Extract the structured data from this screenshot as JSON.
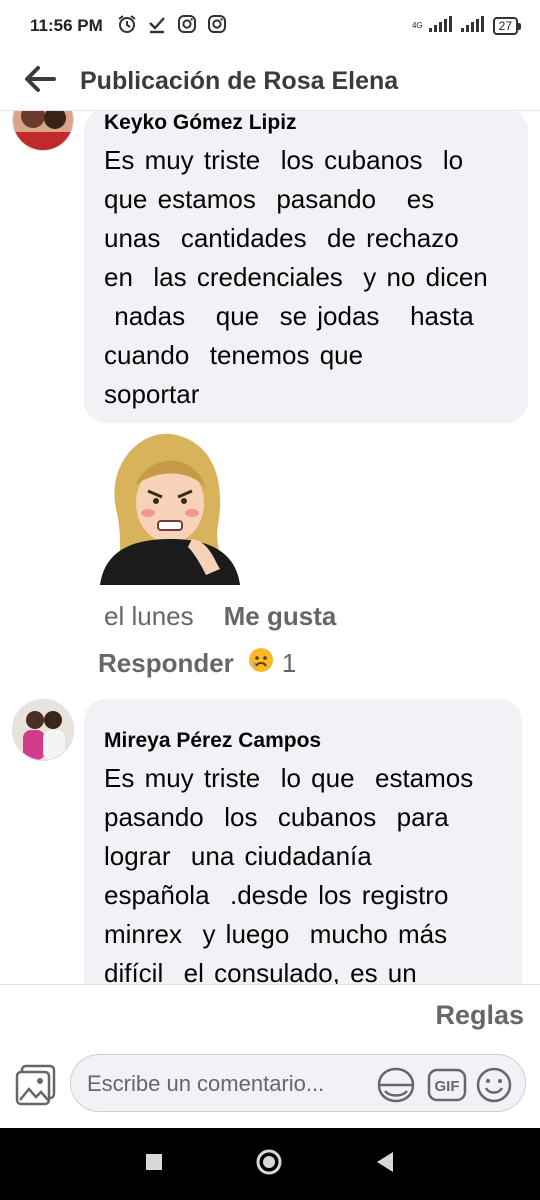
{
  "status_bar": {
    "time": "11:56 PM",
    "network_label": "4G",
    "battery": "27"
  },
  "header": {
    "title": "Publicación de Rosa Elena"
  },
  "comments": [
    {
      "author": "Keyko Gómez Lipiz",
      "text": "Es muy triste  los cubanos  lo\nque estamos  pasando   es\nunas  cantidades  de rechazo\nen  las credenciales  y no dicen\n nadas   que  se jodas   hasta\ncuando  tenemos que\nsoportar",
      "sticker": "angry-woman-sticker",
      "time": "el lunes",
      "like_label": "Me gusta",
      "reply_label": "Responder",
      "reaction_icon": "sad-face-icon",
      "reaction_count": "1"
    },
    {
      "author": "Mireya Pérez Campos",
      "text": "Es muy triste  lo que  estamos\npasando  los  cubanos  para\nlograr  una ciudadanía\nespañola  .desde los registro\nminrex  y luego  mucho más\ndifícil  el consulado, es un"
    }
  ],
  "footer": {
    "rules_label": "Reglas",
    "input_placeholder": "Escribe un comentario...",
    "gif_label": "GIF"
  }
}
